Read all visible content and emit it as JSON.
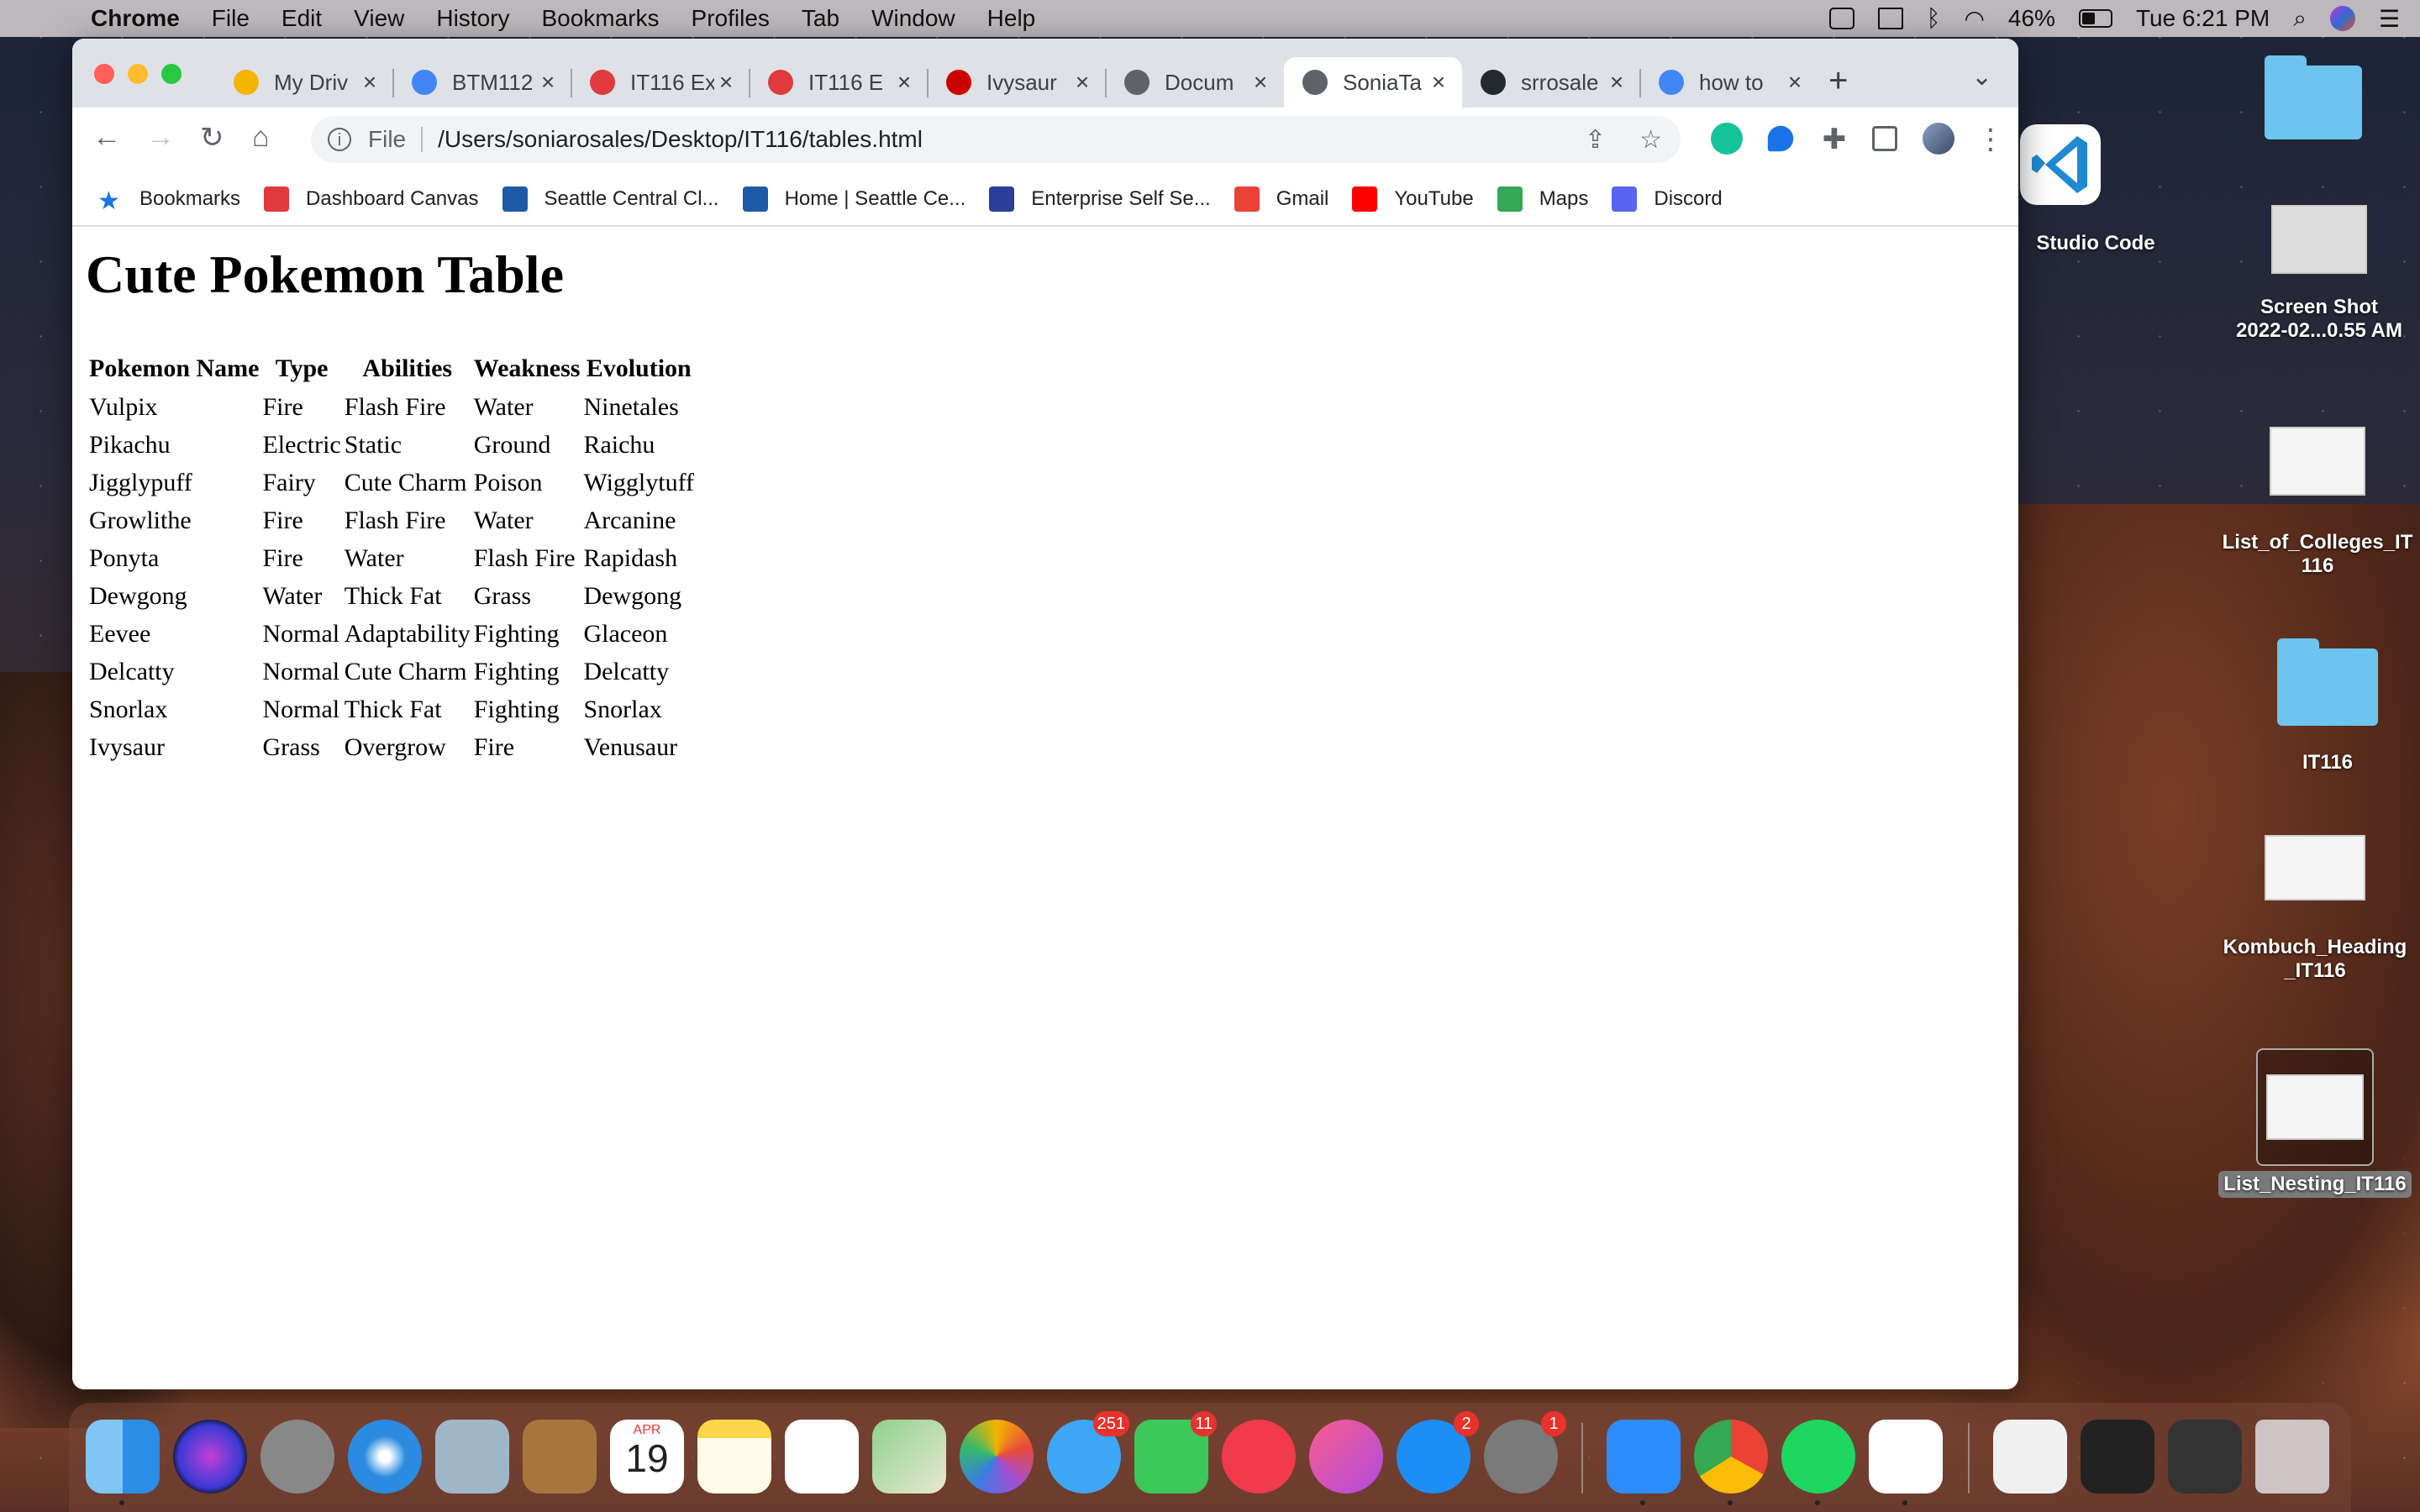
{
  "menubar": {
    "app": "Chrome",
    "items": [
      "File",
      "Edit",
      "View",
      "History",
      "Bookmarks",
      "Profiles",
      "Tab",
      "Window",
      "Help"
    ],
    "battery": "46%",
    "clock": "Tue 6:21 PM"
  },
  "tabs": [
    {
      "title": "My Driv",
      "color": "#f4b400"
    },
    {
      "title": "BTM112",
      "color": "#4285f4"
    },
    {
      "title": "IT116 Ex",
      "color": "#e0393e"
    },
    {
      "title": "IT116 E",
      "color": "#e0393e"
    },
    {
      "title": "Ivysaur",
      "color": "#cc0000"
    },
    {
      "title": "Docum",
      "color": "#5f6368"
    },
    {
      "title": "SoniaTa",
      "color": "#5f6368"
    },
    {
      "title": "srrosale",
      "color": "#24292e"
    },
    {
      "title": "how to",
      "color": "#4285f4"
    }
  ],
  "address": {
    "scheme_label": "File",
    "url": "/Users/soniarosales/Desktop/IT116/tables.html"
  },
  "bookmarks": [
    {
      "label": "Bookmarks",
      "color": "#1a73e8"
    },
    {
      "label": "Dashboard Canvas",
      "color": "#e0393e"
    },
    {
      "label": "Seattle Central Cl...",
      "color": "#1e5aa8"
    },
    {
      "label": "Home | Seattle Ce...",
      "color": "#1e5aa8"
    },
    {
      "label": "Enterprise Self Se...",
      "color": "#2a3f9a"
    },
    {
      "label": "Gmail",
      "color": "#ea4335"
    },
    {
      "label": "YouTube",
      "color": "#ff0000"
    },
    {
      "label": "Maps",
      "color": "#34a853"
    },
    {
      "label": "Discord",
      "color": "#5865f2"
    }
  ],
  "page": {
    "heading": "Cute Pokemon Table",
    "columns": [
      "Pokemon Name",
      "Type",
      "Abilities",
      "Weakness",
      "Evolution"
    ],
    "rows": [
      [
        "Vulpix",
        "Fire",
        "Flash Fire",
        "Water",
        "Ninetales"
      ],
      [
        "Pikachu",
        "Electric",
        "Static",
        "Ground",
        "Raichu"
      ],
      [
        "Jigglypuff",
        "Fairy",
        "Cute Charm",
        "Poison",
        "Wigglytuff"
      ],
      [
        "Growlithe",
        "Fire",
        "Flash Fire",
        "Water",
        "Arcanine"
      ],
      [
        "Ponyta",
        "Fire",
        "Water",
        "Flash Fire",
        "Rapidash"
      ],
      [
        "Dewgong",
        "Water",
        "Thick Fat",
        "Grass",
        "Dewgong"
      ],
      [
        "Eevee",
        "Normal",
        "Adaptability",
        "Fighting",
        "Glaceon"
      ],
      [
        "Delcatty",
        "Normal",
        "Cute Charm",
        "Fighting",
        "Delcatty"
      ],
      [
        "Snorlax",
        "Normal",
        "Thick Fat",
        "Fighting",
        "Snorlax"
      ],
      [
        "Ivysaur",
        "Grass",
        "Overgrow",
        "Fire",
        "Venusaur"
      ]
    ]
  },
  "desktop": {
    "vscode_label": "Studio Code",
    "screenshot_label_1": "Screen Shot",
    "screenshot_label_2": "2022-02...0.55 AM",
    "colleges_label_1": "List_of_Colleges_IT",
    "colleges_label_2": "116",
    "it116_label": "IT116",
    "kombuch_label_1": "Kombuch_Heading",
    "kombuch_label_2": "_IT116",
    "nesting_label": "List_Nesting_IT116"
  },
  "dock": {
    "calendar_month": "APR",
    "calendar_day": "19",
    "messages_badge": "251",
    "facetime_badge": "11",
    "appstore_badge": "2",
    "settings_badge": "1"
  }
}
